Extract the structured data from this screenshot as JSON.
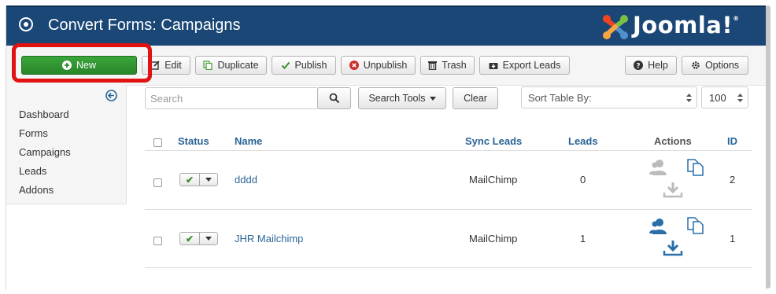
{
  "header": {
    "title": "Convert Forms: Campaigns",
    "logo_text": "Joomla!",
    "logo_mark": "®"
  },
  "toolbar": {
    "new_label": "New",
    "edit_label": "Edit",
    "duplicate_label": "Duplicate",
    "publish_label": "Publish",
    "unpublish_label": "Unpublish",
    "trash_label": "Trash",
    "export_label": "Export Leads",
    "help_label": "Help",
    "options_label": "Options"
  },
  "sidebar": {
    "items": [
      {
        "label": "Dashboard"
      },
      {
        "label": "Forms"
      },
      {
        "label": "Campaigns"
      },
      {
        "label": "Leads"
      },
      {
        "label": "Addons"
      }
    ]
  },
  "filters": {
    "search_placeholder": "Search",
    "search_tools_label": "Search Tools",
    "clear_label": "Clear",
    "sort_label": "Sort Table By:",
    "limit_value": "100"
  },
  "table": {
    "headers": {
      "status": "Status",
      "name": "Name",
      "sync_leads": "Sync Leads",
      "leads": "Leads",
      "actions": "Actions",
      "id": "ID"
    },
    "rows": [
      {
        "name": "dddd",
        "sync_leads": "MailChimp",
        "leads": "0",
        "id": "2"
      },
      {
        "name": "JHR Mailchimp",
        "sync_leads": "MailChimp",
        "leads": "1",
        "id": "1"
      }
    ]
  },
  "colors": {
    "header_bg": "#1a4776",
    "new_button": "#2f912f",
    "highlight": "#e01212",
    "link": "#2a6496",
    "action_icon": "#2a6fa8",
    "action_icon_disabled": "#bbbbbb"
  }
}
